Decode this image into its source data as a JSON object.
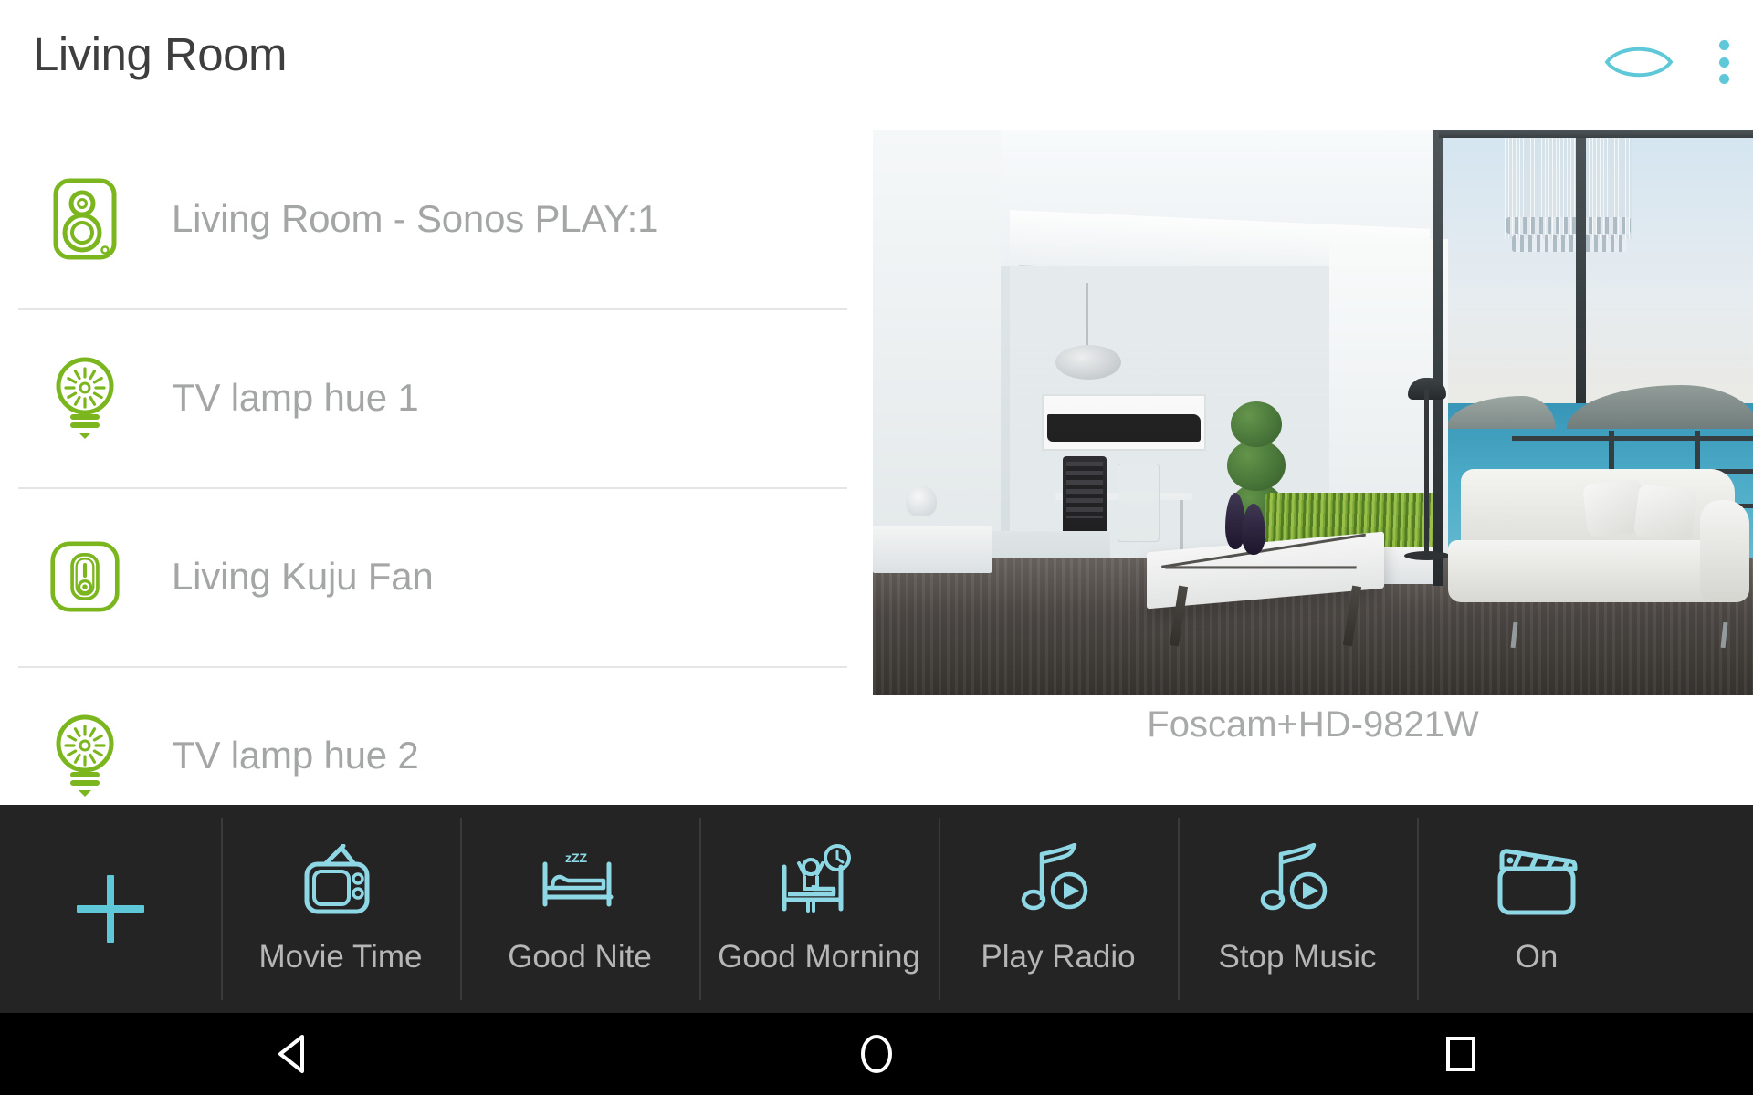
{
  "header": {
    "title": "Living Room",
    "eye_icon": "eye-icon",
    "overflow_icon": "overflow-menu-icon",
    "accent_color": "#5ec8d8"
  },
  "devices": {
    "accent_color": "#7cb61e",
    "items": [
      {
        "label": "Living Room - Sonos PLAY:1",
        "icon": "speaker-icon"
      },
      {
        "label": "TV lamp hue 1",
        "icon": "lightbulb-icon"
      },
      {
        "label": "Living Kuju Fan",
        "icon": "switch-icon"
      },
      {
        "label": "TV lamp hue 2",
        "icon": "lightbulb-icon"
      }
    ]
  },
  "camera": {
    "label": "Foscam+HD-9821W",
    "feed_name": "living-room-camera-feed"
  },
  "scene_toolbar": {
    "background_color": "#242425",
    "accent_color": "#5ec8d8",
    "add_label": "",
    "add_icon": "plus-icon",
    "scenes": [
      {
        "label": "Movie Time",
        "icon": "television-icon"
      },
      {
        "label": "Good Nite",
        "icon": "bed-sleep-icon"
      },
      {
        "label": "Good Morning",
        "icon": "wake-up-clock-icon"
      },
      {
        "label": "Play Radio",
        "icon": "music-note-play-icon"
      },
      {
        "label": "Stop Music",
        "icon": "music-note-play-icon"
      },
      {
        "label": "On",
        "icon": "clapperboard-icon"
      }
    ]
  },
  "android_nav": {
    "back_label": "back-icon",
    "home_label": "home-icon",
    "recents_label": "recents-icon"
  }
}
